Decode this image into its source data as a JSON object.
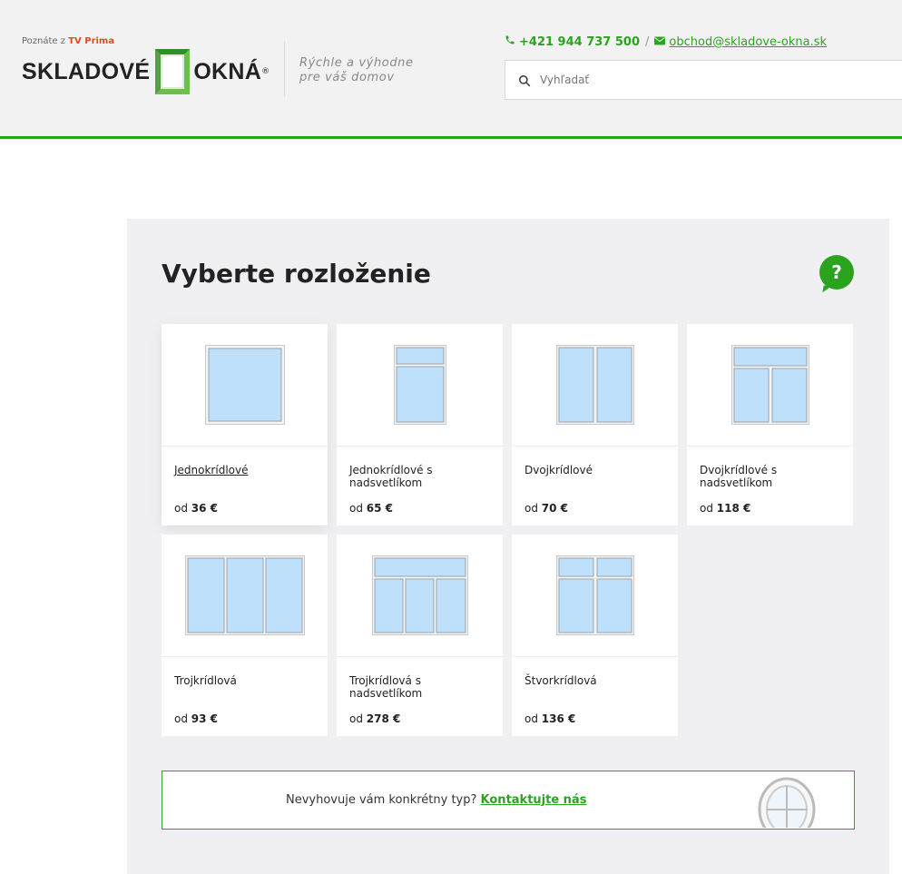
{
  "header": {
    "tv_prefix": "Poznáte z",
    "tv_name": "TV Prima",
    "logo_left": "SKLADOVÉ",
    "logo_right": "OKNÁ",
    "logo_reg": "®",
    "tagline_1": "Rýchle a výhodne",
    "tagline_2": "pre váš domov",
    "phone": "+421 944 737 500",
    "separator": "/",
    "email": "obchod@skladove-okna.sk",
    "search_placeholder": "Vyhľadať"
  },
  "main": {
    "title": "Vyberte rozloženie",
    "help_label": "?",
    "price_prefix": "od",
    "cards": [
      {
        "name": "Jednokrídlové",
        "price": "36 €",
        "layout": "single"
      },
      {
        "name": "Jednokrídlové s nadsvetlíkom",
        "price": "65 €",
        "layout": "single-transom"
      },
      {
        "name": "Dvojkrídlové",
        "price": "70 €",
        "layout": "double"
      },
      {
        "name": "Dvojkrídlové s nadsvetlíkom",
        "price": "118 €",
        "layout": "double-transom"
      },
      {
        "name": "Trojkrídlová",
        "price": "93 €",
        "layout": "triple"
      },
      {
        "name": "Trojkrídlová s nadsvetlíkom",
        "price": "278 €",
        "layout": "triple-transom"
      },
      {
        "name": "Štvorkrídlová",
        "price": "136 €",
        "layout": "quad"
      }
    ],
    "banner_text": "Nevyhovuje vám konkrétny typ?",
    "banner_link": "Kontaktujte nás"
  },
  "colors": {
    "accent": "#2aa31e",
    "glass": "#bfe0fb",
    "frame": "#c9c9c9"
  },
  "icons": [
    "phone-icon",
    "mail-icon",
    "search-icon",
    "help-icon",
    "round-window-icon"
  ]
}
